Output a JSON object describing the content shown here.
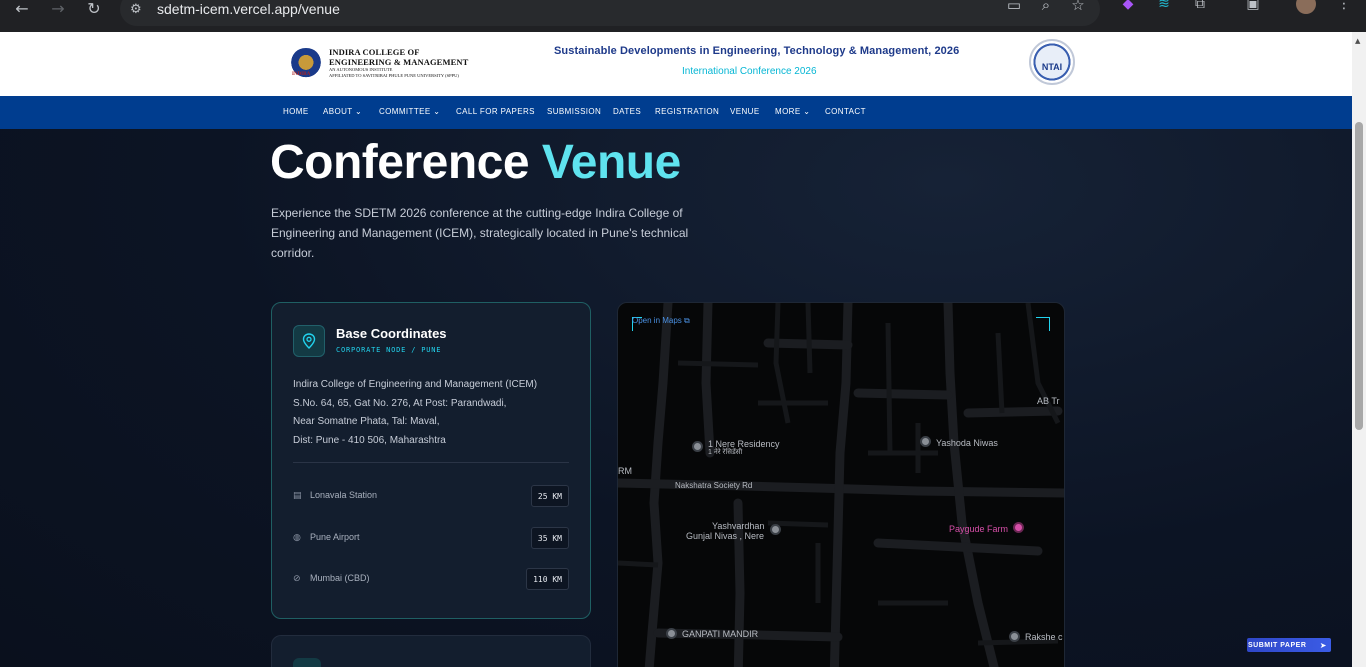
{
  "browser": {
    "url": "sdetm-icem.vercel.app/venue"
  },
  "header": {
    "logo_text": "INDIRA",
    "college_line1": "INDIRA COLLEGE OF",
    "college_line2": "ENGINEERING & MANAGEMENT",
    "college_line3": "AN AUTONOMOUS INSTITUTE",
    "college_line4": "AFFILIATED TO SAVITRIBAI PHULE PUNE UNIVERSITY (SPPU)",
    "conference_title": "Sustainable Developments in Engineering, Technology & Management, 2026",
    "conference_subtitle": "International Conference 2026",
    "partner_logo_text": "NTAI"
  },
  "nav": {
    "items": [
      {
        "label": "HOME"
      },
      {
        "label": "ABOUT ⌄"
      },
      {
        "label": "COMMITTEE ⌄"
      },
      {
        "label": "CALL FOR PAPERS"
      },
      {
        "label": "SUBMISSION"
      },
      {
        "label": "DATES"
      },
      {
        "label": "REGISTRATION"
      },
      {
        "label": "VENUE"
      },
      {
        "label": "MORE ⌄"
      },
      {
        "label": "CONTACT"
      }
    ]
  },
  "hero": {
    "title_main": "Conference ",
    "title_accent": "Venue",
    "intro": "Experience the SDETM 2026 conference at the cutting-edge Indira College of Engineering and Management (ICEM), strategically located in Pune's technical corridor."
  },
  "coordinates_card": {
    "title": "Base Coordinates",
    "kicker": "CORPORATE NODE / PUNE",
    "address": [
      "Indira College of Engineering and Management (ICEM)",
      "S.No. 64, 65, Gat No. 276, At Post: Parandwadi,",
      "Near Somatne Phata, Tal: Maval,",
      "Dist: Pune - 410 506, Maharashtra"
    ],
    "distances": [
      {
        "icon": "train-icon",
        "label": "Lonavala Station",
        "value": "25 KM"
      },
      {
        "icon": "globe-icon",
        "label": "Pune Airport",
        "value": "35 KM"
      },
      {
        "icon": "compass-icon",
        "label": "Mumbai (CBD)",
        "value": "110 KM"
      }
    ]
  },
  "map": {
    "open_link": "Open in Maps",
    "places": [
      {
        "name": "1 Nere Residency",
        "sub": "1 नेरे रेसिडेंसी"
      },
      {
        "name": "Yashoda Niwas"
      },
      {
        "name": "Nakshatra Society Rd"
      },
      {
        "name": "Yashvardhan"
      },
      {
        "name": "Gunjal Nivas , Nere"
      },
      {
        "name": "Paygude Farm"
      },
      {
        "name": "GANPATI MANDIR"
      },
      {
        "name": "Rakshe c"
      },
      {
        "name": "AB Tr"
      },
      {
        "name": "RM"
      }
    ]
  },
  "floating": {
    "submit_label": "SUBMIT PAPER"
  },
  "colors": {
    "nav_bg": "#003d8f",
    "accent_cyan": "#5fe3ef",
    "page_bg": "#0b1120",
    "map_poi_pink": "#d64fa8"
  }
}
